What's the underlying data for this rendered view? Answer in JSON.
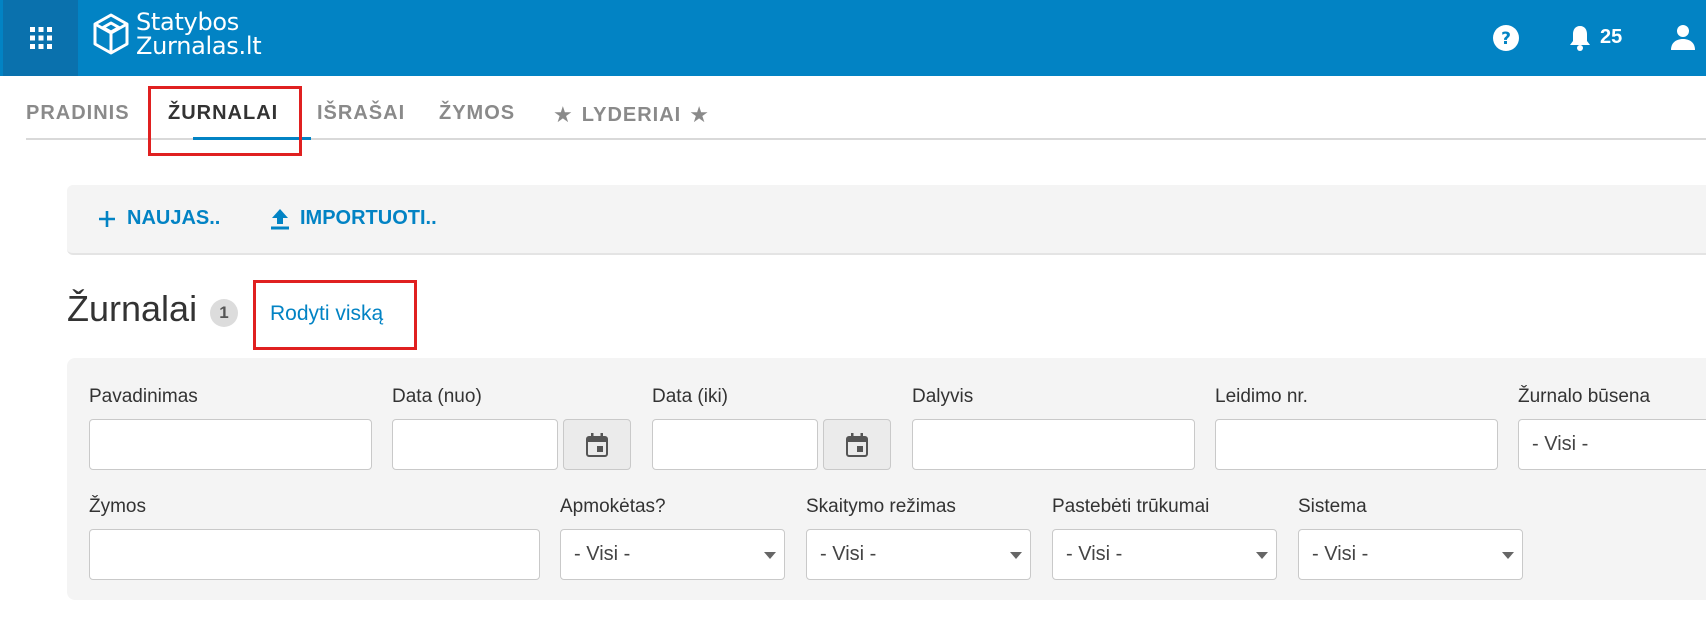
{
  "header": {
    "logo_line1": "Statybos",
    "logo_line2": "Zurnalas.lt",
    "notification_count": "25"
  },
  "tabs": [
    {
      "label": "PRADINIS"
    },
    {
      "label": "ŽURNALAI"
    },
    {
      "label": "IŠRAŠAI"
    },
    {
      "label": "ŽYMOS"
    },
    {
      "label": "LYDERIAI"
    }
  ],
  "toolbar": {
    "new_label": "NAUJAS..",
    "import_label": "IMPORTUOTI.."
  },
  "page": {
    "title": "Žurnalai",
    "count": "1",
    "show_all": "Rodyti viską"
  },
  "filters": {
    "name_label": "Pavadinimas",
    "date_from_label": "Data (nuo)",
    "date_to_label": "Data (iki)",
    "participant_label": "Dalyvis",
    "permit_label": "Leidimo nr.",
    "status_label": "Žurnalo būsena",
    "status_value": "- Visi -",
    "tags_label": "Žymos",
    "paid_label": "Apmokėtas?",
    "paid_value": "- Visi -",
    "read_mode_label": "Skaitymo režimas",
    "read_mode_value": "- Visi -",
    "defects_label": "Pastebėti trūkumai",
    "defects_value": "- Visi -",
    "system_label": "Sistema",
    "system_value": "- Visi -"
  },
  "colors": {
    "brand": "#0283c4",
    "highlight": "#e02020"
  }
}
